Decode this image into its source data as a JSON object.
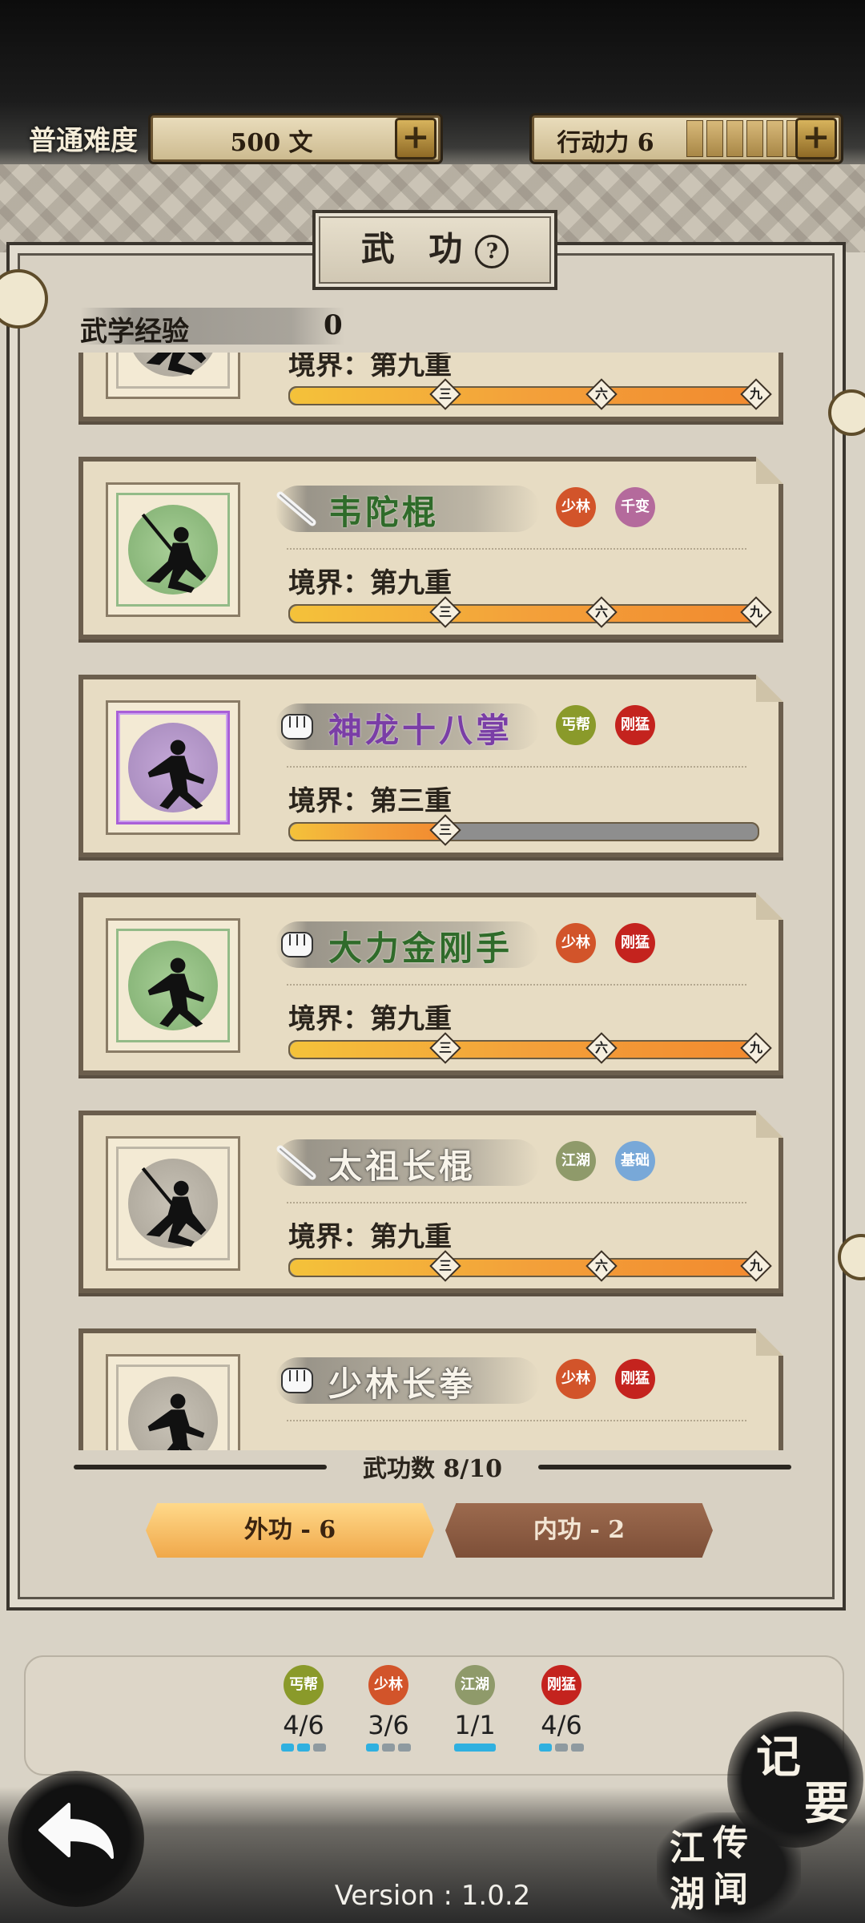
{
  "header": {
    "difficulty": "普通难度",
    "money": "500 文",
    "action_label": "行动力 6",
    "action_pips": 6
  },
  "panel": {
    "title": "武 功",
    "help_icon": "?",
    "exp_label": "武学经验",
    "exp_value": "0"
  },
  "skills": [
    {
      "name": "",
      "weapon": "staff",
      "realm": "境界：第九重",
      "progress": 1.0,
      "portrait": "grey",
      "tags": []
    },
    {
      "name": "韦陀棍",
      "weapon": "staff",
      "realm": "境界：第九重",
      "progress": 1.0,
      "portrait": "green",
      "name_color": "green",
      "tags": [
        {
          "text": "少林",
          "color": "#d2542a"
        },
        {
          "text": "千变",
          "color": "#b46a9c"
        }
      ]
    },
    {
      "name": "神龙十八掌",
      "weapon": "fist",
      "realm": "境界：第三重",
      "progress": 0.333,
      "portrait": "purple",
      "name_color": "purple",
      "tags": [
        {
          "text": "丐帮",
          "color": "#8a9a2a"
        },
        {
          "text": "刚猛",
          "color": "#c4231e"
        }
      ]
    },
    {
      "name": "大力金刚手",
      "weapon": "fist",
      "realm": "境界：第九重",
      "progress": 1.0,
      "portrait": "green",
      "name_color": "green",
      "tags": [
        {
          "text": "少林",
          "color": "#d2542a"
        },
        {
          "text": "刚猛",
          "color": "#c4231e"
        }
      ]
    },
    {
      "name": "太祖长棍",
      "weapon": "staff",
      "realm": "境界：第九重",
      "progress": 1.0,
      "portrait": "grey",
      "name_color": "white",
      "tags": [
        {
          "text": "江湖",
          "color": "#8f9a6a"
        },
        {
          "text": "基础",
          "color": "#78a8d8"
        }
      ]
    },
    {
      "name": "少林长拳",
      "weapon": "fist",
      "realm": "",
      "progress": 1.0,
      "portrait": "grey",
      "name_color": "white",
      "tags": [
        {
          "text": "少林",
          "color": "#d2542a"
        },
        {
          "text": "刚猛",
          "color": "#c4231e"
        }
      ]
    }
  ],
  "markers": [
    "三",
    "六",
    "九"
  ],
  "count_text": "武功数 8/10",
  "tabs": {
    "outer": "外功 - 6",
    "inner": "内功 - 2"
  },
  "factions": [
    {
      "text": "丐帮",
      "color": "#8a9a2a",
      "count": "4/6",
      "filled": 2,
      "total": 3
    },
    {
      "text": "少林",
      "color": "#d2542a",
      "count": "3/6",
      "filled": 1,
      "total": 3
    },
    {
      "text": "江湖",
      "color": "#8f9a6a",
      "count": "1/1",
      "filled": 1,
      "total": 1
    },
    {
      "text": "刚猛",
      "color": "#c4231e",
      "count": "4/6",
      "filled": 1,
      "total": 3
    }
  ],
  "bottom": {
    "memo_1": "记",
    "memo_2": "要",
    "news": [
      "江",
      "湖",
      "传",
      "闻"
    ],
    "version": "Version : 1.0.2"
  }
}
